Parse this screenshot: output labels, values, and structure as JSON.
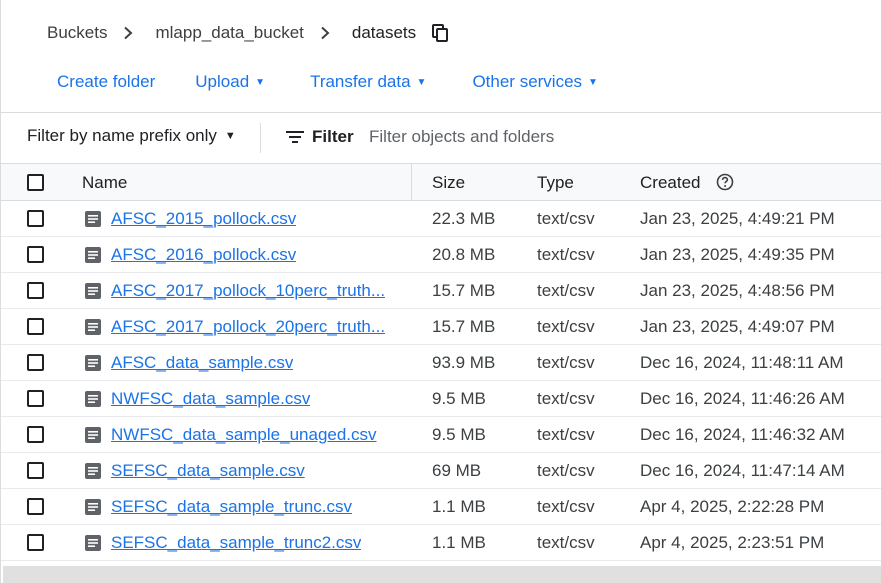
{
  "breadcrumb": {
    "items": [
      "Buckets",
      "mlapp_data_bucket"
    ],
    "current": "datasets",
    "separator": ">"
  },
  "actions": {
    "create_folder": "Create folder",
    "upload": "Upload",
    "transfer_data": "Transfer data",
    "other_services": "Other services"
  },
  "filter": {
    "prefix_label": "Filter by name prefix only",
    "label": "Filter",
    "placeholder": "Filter objects and folders"
  },
  "table": {
    "columns": {
      "name": "Name",
      "size": "Size",
      "type": "Type",
      "created": "Created"
    },
    "rows": [
      {
        "name": "AFSC_2015_pollock.csv",
        "size": "22.3 MB",
        "type": "text/csv",
        "created": "Jan 23, 2025, 4:49:21 PM"
      },
      {
        "name": "AFSC_2016_pollock.csv",
        "size": "20.8 MB",
        "type": "text/csv",
        "created": "Jan 23, 2025, 4:49:35 PM"
      },
      {
        "name": "AFSC_2017_pollock_10perc_truth...",
        "size": "15.7 MB",
        "type": "text/csv",
        "created": "Jan 23, 2025, 4:48:56 PM"
      },
      {
        "name": "AFSC_2017_pollock_20perc_truth...",
        "size": "15.7 MB",
        "type": "text/csv",
        "created": "Jan 23, 2025, 4:49:07 PM"
      },
      {
        "name": "AFSC_data_sample.csv",
        "size": "93.9 MB",
        "type": "text/csv",
        "created": "Dec 16, 2024, 11:48:11 AM"
      },
      {
        "name": "NWFSC_data_sample.csv",
        "size": "9.5 MB",
        "type": "text/csv",
        "created": "Dec 16, 2024, 11:46:26 AM"
      },
      {
        "name": "NWFSC_data_sample_unaged.csv",
        "size": "9.5 MB",
        "type": "text/csv",
        "created": "Dec 16, 2024, 11:46:32 AM"
      },
      {
        "name": "SEFSC_data_sample.csv",
        "size": "69 MB",
        "type": "text/csv",
        "created": "Dec 16, 2024, 11:47:14 AM"
      },
      {
        "name": "SEFSC_data_sample_trunc.csv",
        "size": "1.1 MB",
        "type": "text/csv",
        "created": "Apr 4, 2025, 2:22:28 PM"
      },
      {
        "name": "SEFSC_data_sample_trunc2.csv",
        "size": "1.1 MB",
        "type": "text/csv",
        "created": "Apr 4, 2025, 2:23:51 PM"
      }
    ]
  },
  "icons": {
    "copy": "copy-icon",
    "filter": "filter-icon",
    "help": "help-icon",
    "file": "file-icon"
  },
  "colors": {
    "link": "#1a73e8",
    "header_bg": "#f8f9fa",
    "border": "#dadce0",
    "file_icon": "#5f6368"
  }
}
